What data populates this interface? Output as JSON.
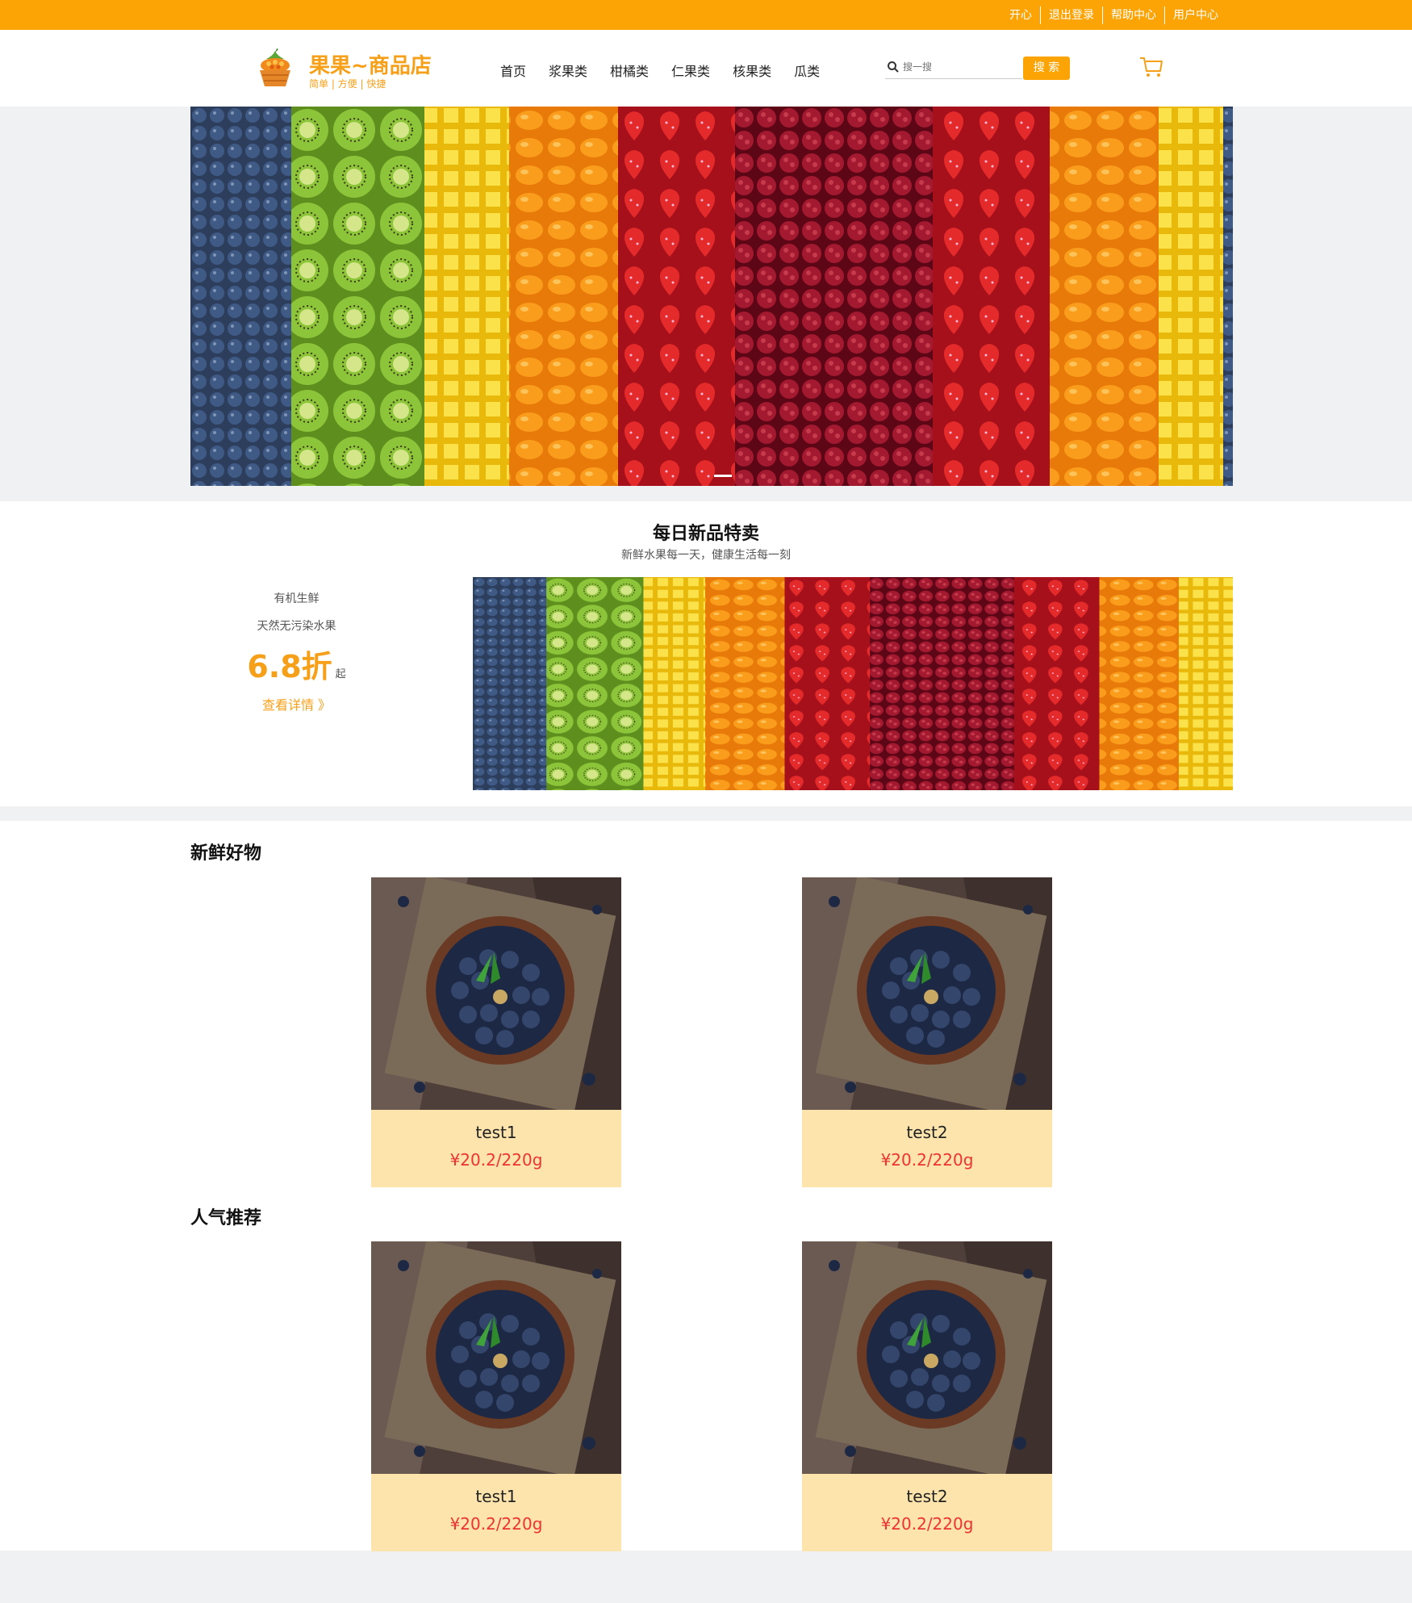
{
  "topbar": {
    "links": [
      "开心",
      "退出登录",
      "帮助中心",
      "用户中心"
    ]
  },
  "header": {
    "logo_title": "果果~商品店",
    "logo_sub": "简单 | 方便 | 快捷",
    "nav": [
      "首页",
      "浆果类",
      "柑橘类",
      "仁果类",
      "核果类",
      "瓜类"
    ],
    "search_placeholder": "搜一搜",
    "search_button": "搜 索"
  },
  "daily": {
    "title": "每日新品特卖",
    "subtitle": "新鲜水果每一天，健康生活每一刻",
    "promo_line1": "有机生鲜",
    "promo_line2": "天然无污染水果",
    "promo_price": "6.8折",
    "promo_suffix": "起",
    "promo_more": "查看详情 》"
  },
  "sections": [
    {
      "title": "新鲜好物",
      "items": [
        {
          "name": "test1",
          "price": "¥20.2/220g"
        },
        {
          "name": "test2",
          "price": "¥20.2/220g"
        }
      ]
    },
    {
      "title": "人气推荐",
      "items": [
        {
          "name": "test1",
          "price": "¥20.2/220g"
        },
        {
          "name": "test2",
          "price": "¥20.2/220g"
        }
      ]
    }
  ],
  "colors": {
    "accent": "#fca405",
    "price": "#e33333",
    "card_info_bg": "#fde4ad"
  }
}
